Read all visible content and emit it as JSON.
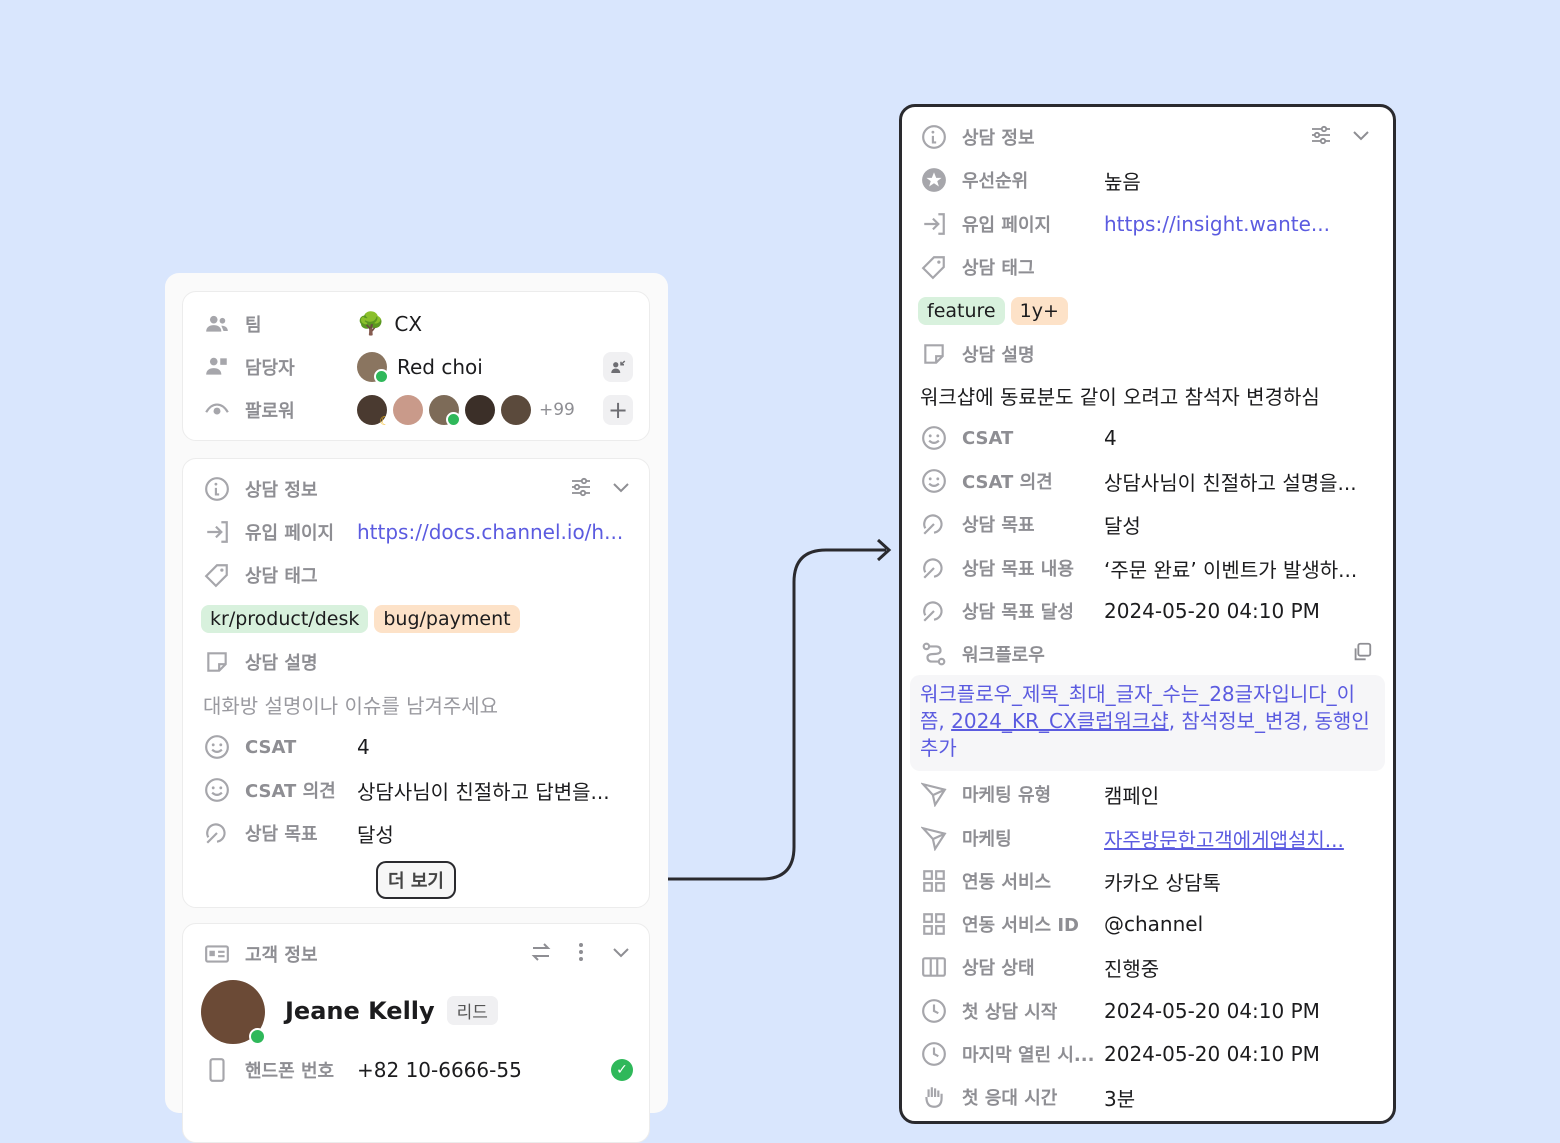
{
  "left": {
    "team": {
      "label": "팀",
      "value": "CX"
    },
    "assignee": {
      "label": "담당자",
      "value": "Red choi"
    },
    "follower": {
      "label": "팔로워",
      "extra": "+99"
    },
    "consult": {
      "title": "상담 정보",
      "inflow": {
        "label": "유입 페이지",
        "value": "https://docs.channel.io/h..."
      },
      "tags_label": "상담 태그",
      "tags": [
        "kr/product/desk",
        "bug/payment"
      ],
      "desc": {
        "label": "상담 설명",
        "placeholder": "대화방 설명이나 이슈를 남겨주세요"
      },
      "csat": {
        "label": "CSAT",
        "value": "4"
      },
      "csat_opinion": {
        "label": "CSAT 의견",
        "value": "상담사님이 친절하고 답변을..."
      },
      "goal": {
        "label": "상담 목표",
        "value": "달성"
      },
      "more": "더 보기"
    },
    "customer": {
      "title": "고객 정보",
      "name": "Jeane Kelly",
      "badge": "리드",
      "phone": {
        "label": "핸드폰 번호",
        "value": "+82 10-6666-55"
      }
    }
  },
  "right": {
    "title": "상담 정보",
    "priority": {
      "label": "우선순위",
      "value": "높음"
    },
    "inflow": {
      "label": "유입 페이지",
      "value": "https://insight.wante..."
    },
    "tags_label": "상담 태그",
    "tags": [
      "feature",
      "1y+"
    ],
    "desc_label": "상담 설명",
    "desc_text": "워크샵에 동료분도 같이 오려고 참석자 변경하심",
    "csat": {
      "label": "CSAT",
      "value": "4"
    },
    "csat_opinion": {
      "label": "CSAT 의견",
      "value": "상담사님이 친절하고 설명을..."
    },
    "goal": {
      "label": "상담 목표",
      "value": "달성"
    },
    "goal_content": {
      "label": "상담 목표 내용",
      "value": "‘주문 완료’ 이벤트가 발생하..."
    },
    "goal_achieved": {
      "label": "상담 목표 달성",
      "value": "2024-05-20 04:10 PM"
    },
    "workflow_label": "워크플로우",
    "workflow": {
      "part1": "워크플로우_제목_최대_글자_수는_28글자입니다_이쯤, ",
      "link": "2024_KR_CX클럽워크샵",
      "part2": ", 참석정보_변경, 동행인추가"
    },
    "marketing_type": {
      "label": "마케팅 유형",
      "value": "캠페인"
    },
    "marketing": {
      "label": "마케팅",
      "value": "자주방문한고객에게앱설치..."
    },
    "linked_service": {
      "label": "연동 서비스",
      "value": "카카오 상담톡"
    },
    "linked_service_id": {
      "label": "연동 서비스 ID",
      "value": "@channel"
    },
    "status": {
      "label": "상담 상태",
      "value": "진행중"
    },
    "first_start": {
      "label": "첫 상담 시작",
      "value": "2024-05-20 04:10 PM"
    },
    "last_open": {
      "label": "마지막 열린 시...",
      "value": "2024-05-20 04:10 PM"
    },
    "first_response": {
      "label": "첫 응대 시간",
      "value": "3분"
    }
  }
}
